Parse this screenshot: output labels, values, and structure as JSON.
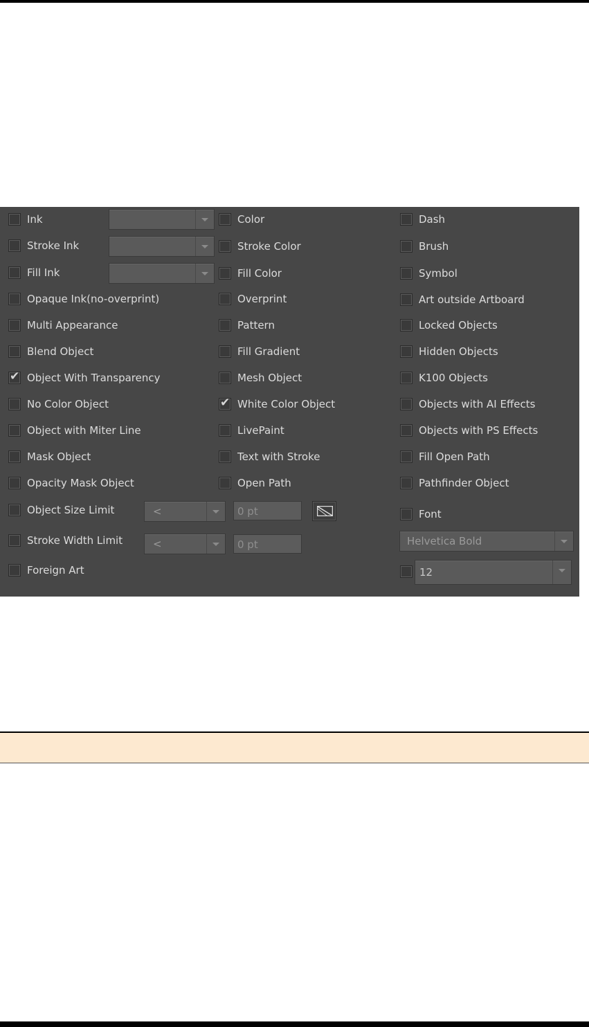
{
  "panel": {
    "col1": [
      {
        "label": "Ink",
        "checked": false
      },
      {
        "label": "Stroke Ink",
        "checked": false
      },
      {
        "label": "Fill Ink",
        "checked": false
      },
      {
        "label": "Opaque Ink(no-overprint)",
        "checked": false
      },
      {
        "label": "Multi Appearance",
        "checked": false
      },
      {
        "label": "Blend Object",
        "checked": false
      },
      {
        "label": "Object With Transparency",
        "checked": true
      },
      {
        "label": "No Color Object",
        "checked": false
      },
      {
        "label": "Object with Miter Line",
        "checked": false
      },
      {
        "label": "Mask Object",
        "checked": false
      },
      {
        "label": "Opacity Mask Object",
        "checked": false
      },
      {
        "label": "Object Size Limit",
        "checked": false
      },
      {
        "label": "Stroke Width Limit",
        "checked": false
      },
      {
        "label": "Foreign Art",
        "checked": false
      }
    ],
    "col2": [
      {
        "label": "Color",
        "checked": false
      },
      {
        "label": "Stroke Color",
        "checked": false
      },
      {
        "label": "Fill Color",
        "checked": false
      },
      {
        "label": "Overprint",
        "checked": false
      },
      {
        "label": "Pattern",
        "checked": false
      },
      {
        "label": "Fill Gradient",
        "checked": false
      },
      {
        "label": "Mesh Object",
        "checked": false
      },
      {
        "label": "White Color Object",
        "checked": true
      },
      {
        "label": "LivePaint",
        "checked": false
      },
      {
        "label": "Text with Stroke",
        "checked": false
      },
      {
        "label": "Open Path",
        "checked": false
      }
    ],
    "col3": [
      {
        "label": "Dash",
        "checked": false
      },
      {
        "label": "Brush",
        "checked": false
      },
      {
        "label": "Symbol",
        "checked": false
      },
      {
        "label": "Art outside Artboard",
        "checked": false
      },
      {
        "label": "Locked Objects",
        "checked": false
      },
      {
        "label": "Hidden Objects",
        "checked": false
      },
      {
        "label": "K100 Objects",
        "checked": false
      },
      {
        "label": "Objects with AI Effects",
        "checked": false
      },
      {
        "label": "Objects with PS Effects",
        "checked": false
      },
      {
        "label": "Fill Open Path",
        "checked": false
      },
      {
        "label": "Pathfinder Object",
        "checked": false
      },
      {
        "label": "Font",
        "checked": false
      }
    ],
    "size_limit_operator": "<",
    "size_limit_value": "0 pt",
    "stroke_limit_operator": "<",
    "stroke_limit_value": "0 pt",
    "font_name": "Helvetica Bold",
    "font_size": "12",
    "icons": {
      "size_toggle": "diagonal-resize-icon",
      "check": "checkmark-icon"
    }
  }
}
